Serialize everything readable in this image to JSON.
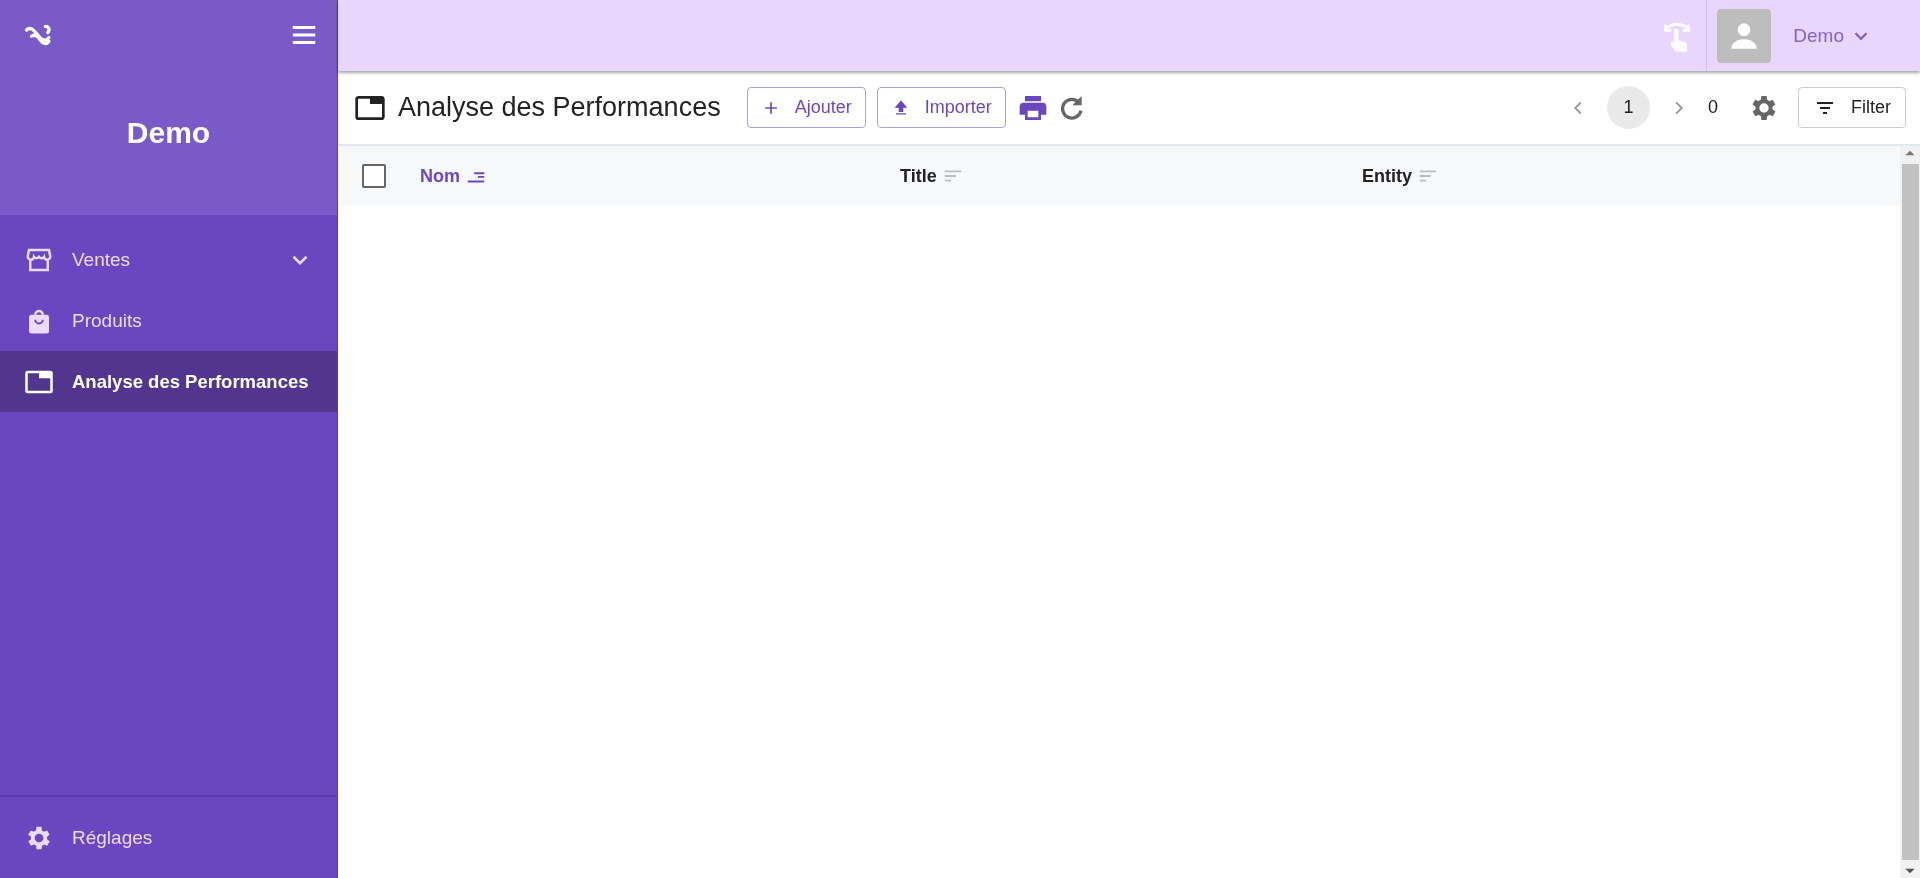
{
  "sidebar": {
    "title": "Demo",
    "items": [
      {
        "label": "Ventes",
        "kind": "group",
        "expanded": false,
        "selected": false
      },
      {
        "label": "Produits",
        "kind": "link",
        "selected": false
      },
      {
        "label": "Analyse des Performances",
        "kind": "link",
        "selected": true
      }
    ],
    "footer_item": {
      "label": "Réglages"
    }
  },
  "topbar": {
    "user": "Demo"
  },
  "toolbar": {
    "title": "Analyse des Performances",
    "buttons": [
      "Ajouter",
      "Importer"
    ],
    "pagination": {
      "current_page": "1",
      "total": "0"
    },
    "filter": "Filter"
  },
  "table": {
    "select_all_checked": false,
    "columns": [
      {
        "label": "Nom",
        "sorted": true
      },
      {
        "label": "Title",
        "sorted": false
      },
      {
        "label": "Entity",
        "sorted": false
      }
    ]
  }
}
